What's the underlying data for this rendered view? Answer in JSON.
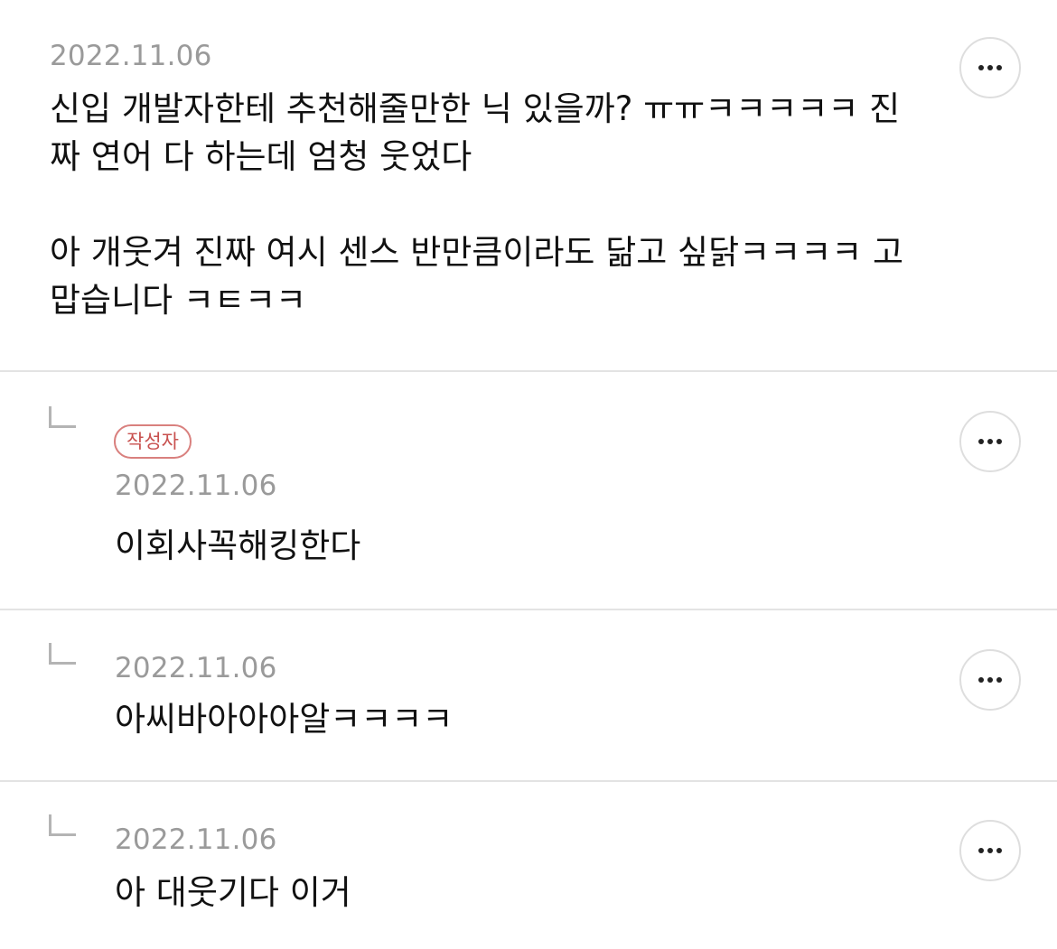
{
  "comments": [
    {
      "date": "2022.11.06",
      "text": "신입 개발자한테 추천해줄만한 닉 있을까? ㅠㅠㅋㅋㅋㅋㅋ 진\n짜 연어 다 하는데 엄청 웃었다\n\n아 개웃겨 진짜 여시 센스 반만큼이라도 닮고 싶닭ㅋㅋㅋㅋ 고\n맙습니다 ㅋㅌㅋㅋ"
    },
    {
      "badge": "작성자",
      "date": "2022.11.06",
      "text": "이회사꼭해킹한다"
    },
    {
      "date": "2022.11.06",
      "text": "아씨바아아아알ㅋㅋㅋㅋ"
    },
    {
      "date": "2022.11.06",
      "text": "아 대웃기다 이거"
    }
  ],
  "icons": {
    "more": "more-horizontal-icon",
    "reply": "reply-arrow-icon"
  },
  "colors": {
    "divider": "#e3e3e3",
    "date": "#9a9a9a",
    "badge": "#c8514f"
  }
}
